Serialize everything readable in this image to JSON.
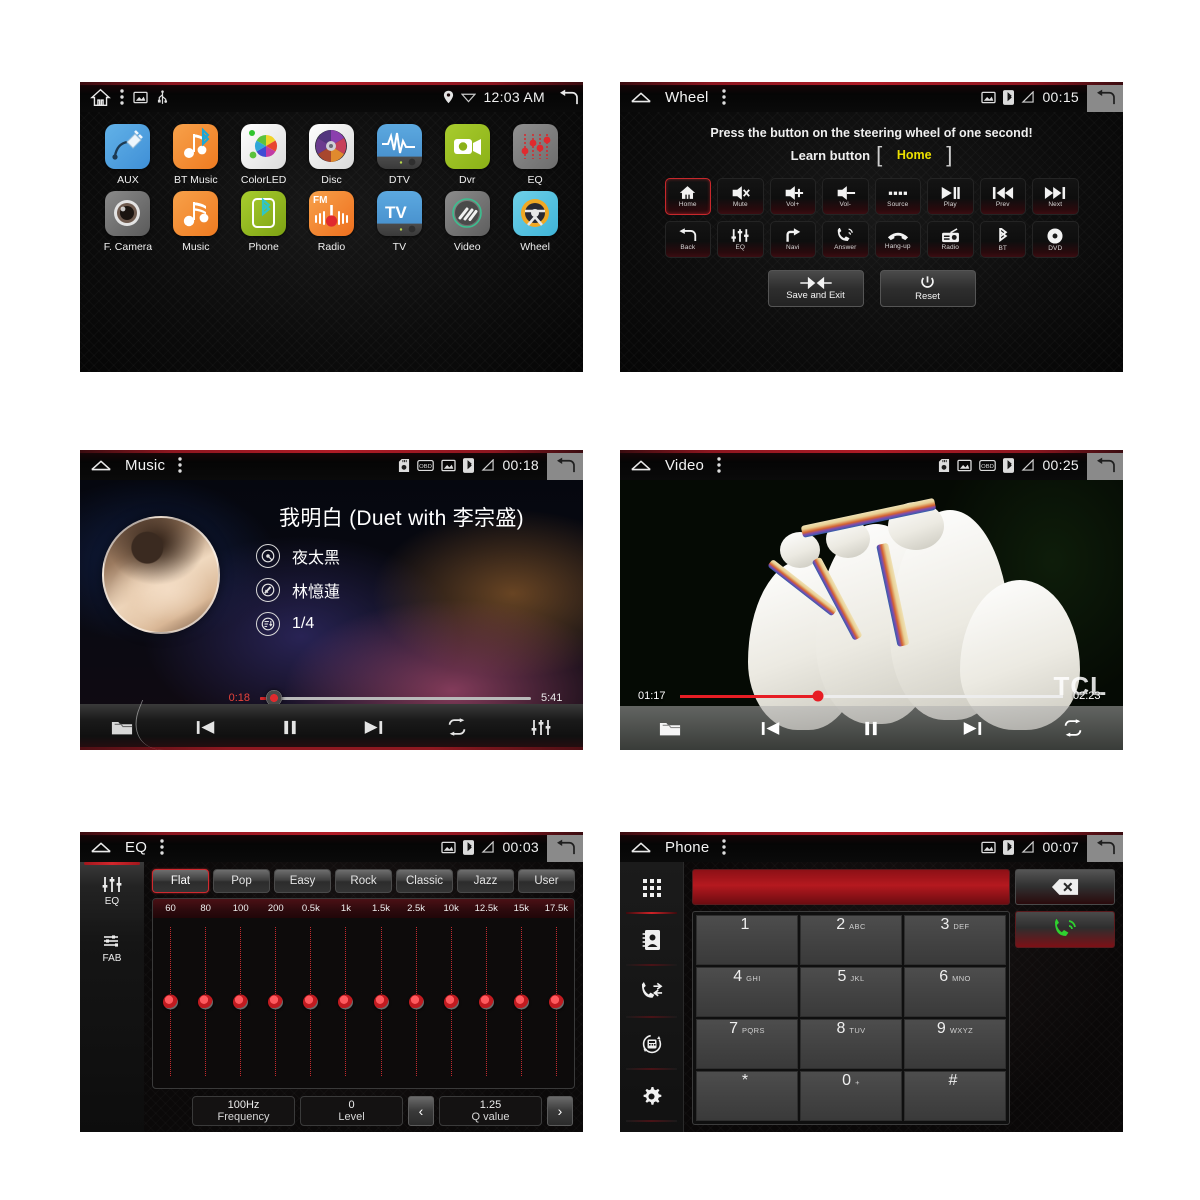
{
  "home": {
    "statusbar": {
      "icons": [
        "home-icon",
        "overflow-menu-icon",
        "gallery-icon",
        "usb-icon"
      ],
      "right_icons": [
        "location-pin-icon",
        "wifi-icon"
      ],
      "time": "12:03 AM",
      "back": "back-icon"
    },
    "apps": [
      {
        "label": "AUX",
        "icon": "aux-plug-icon"
      },
      {
        "label": "BT Music",
        "icon": "bt-music-icon"
      },
      {
        "label": "ColorLED",
        "icon": "color-wheel-icon"
      },
      {
        "label": "Disc",
        "icon": "disc-icon"
      },
      {
        "label": "DTV",
        "icon": "dtv-waveform-icon"
      },
      {
        "label": "Dvr",
        "icon": "dvr-camera-icon"
      },
      {
        "label": "EQ",
        "icon": "eq-sliders-icon"
      },
      {
        "label": "F. Camera",
        "icon": "front-camera-icon"
      },
      {
        "label": "Music",
        "icon": "music-note-icon"
      },
      {
        "label": "Phone",
        "icon": "phone-bluetooth-icon"
      },
      {
        "label": "Radio",
        "icon": "radio-fm-icon"
      },
      {
        "label": "TV",
        "icon": "tv-icon"
      },
      {
        "label": "Video",
        "icon": "video-icon"
      },
      {
        "label": "Wheel",
        "icon": "steering-wheel-icon"
      }
    ]
  },
  "wheel": {
    "statusbar": {
      "title": "Wheel",
      "time": "00:15"
    },
    "instruction": "Press the button on the steering wheel of one second!",
    "learn_label": "Learn button",
    "learn_value": "Home",
    "learn_value_color": "#ece000",
    "buttons": [
      {
        "label": "Home",
        "icon": "home-icon",
        "selected": true
      },
      {
        "label": "Mute",
        "icon": "volume-mute-icon",
        "selected": false
      },
      {
        "label": "Vol+",
        "icon": "volume-up-icon",
        "selected": false
      },
      {
        "label": "Vol-",
        "icon": "volume-down-icon",
        "selected": false
      },
      {
        "label": "Source",
        "icon": "source-dots-icon",
        "selected": false
      },
      {
        "label": "Play",
        "icon": "play-pause-icon",
        "selected": false
      },
      {
        "label": "Prev",
        "icon": "prev-track-icon",
        "selected": false
      },
      {
        "label": "Next",
        "icon": "next-track-icon",
        "selected": false
      },
      {
        "label": "Back",
        "icon": "back-arrow-icon",
        "selected": false
      },
      {
        "label": "EQ",
        "icon": "eq-sliders-icon",
        "selected": false
      },
      {
        "label": "Navi",
        "icon": "navi-turn-icon",
        "selected": false
      },
      {
        "label": "Answer",
        "icon": "call-answer-icon",
        "selected": false
      },
      {
        "label": "Hang-up",
        "icon": "call-hangup-icon",
        "selected": false
      },
      {
        "label": "Radio",
        "icon": "radio-icon",
        "selected": false
      },
      {
        "label": "BT",
        "icon": "bluetooth-icon",
        "selected": false
      },
      {
        "label": "DVD",
        "icon": "dvd-disc-icon",
        "selected": false
      }
    ],
    "actions": [
      {
        "label": "Save and Exit",
        "icon": "save-exit-arrows-icon"
      },
      {
        "label": "Reset",
        "icon": "reset-circle-icon"
      }
    ]
  },
  "music": {
    "statusbar": {
      "title": "Music",
      "time": "00:18",
      "icons": [
        "sd-card-icon",
        "obd-icon",
        "gallery-icon",
        "bluetooth-icon",
        "signal-icon"
      ]
    },
    "track_title": "我明白 (Duet with 李宗盛)",
    "album": "夜太黑",
    "artist": "林憶蓮",
    "index": "1/4",
    "current_time": "0:18",
    "total_time": "5:41",
    "progress_percent": 5,
    "controls": [
      "folder-icon",
      "prev-track-icon",
      "pause-icon",
      "next-track-icon",
      "repeat-icon",
      "eq-sliders-icon"
    ]
  },
  "video": {
    "statusbar": {
      "title": "Video",
      "time": "00:25",
      "icons": [
        "sd-card-icon",
        "gallery-icon",
        "obd-icon",
        "bluetooth-icon",
        "signal-icon"
      ]
    },
    "current_time": "01:17",
    "total_time": "02:23",
    "progress_percent": 36,
    "watermark": "TCL",
    "controls": [
      "folder-icon",
      "prev-track-icon",
      "pause-icon",
      "next-track-icon",
      "repeat-icon"
    ]
  },
  "eq": {
    "statusbar": {
      "title": "EQ",
      "time": "00:03"
    },
    "sidebar": [
      {
        "label": "EQ",
        "icon": "eq-sliders-icon",
        "active": true
      },
      {
        "label": "FAB",
        "icon": "fader-balance-icon",
        "active": false
      }
    ],
    "presets": [
      {
        "label": "Flat",
        "selected": true
      },
      {
        "label": "Pop",
        "selected": false
      },
      {
        "label": "Easy",
        "selected": false
      },
      {
        "label": "Rock",
        "selected": false
      },
      {
        "label": "Classic",
        "selected": false
      },
      {
        "label": "Jazz",
        "selected": false
      },
      {
        "label": "User",
        "selected": false
      }
    ],
    "bands": [
      "60",
      "80",
      "100",
      "200",
      "0.5k",
      "1k",
      "1.5k",
      "2.5k",
      "10k",
      "12.5k",
      "15k",
      "17.5k"
    ],
    "band_levels": [
      0,
      0,
      0,
      0,
      0,
      0,
      0,
      0,
      0,
      0,
      0,
      0
    ],
    "fields": [
      {
        "value": "100Hz",
        "key": "Frequency"
      },
      {
        "value": "0",
        "key": "Level"
      },
      {
        "value": "1.25",
        "key": "Q value"
      }
    ],
    "nav_prev": "‹",
    "nav_next": "›"
  },
  "phone": {
    "statusbar": {
      "title": "Phone",
      "time": "00:07"
    },
    "sidebar": [
      {
        "icon": "dialpad-icon",
        "active": true
      },
      {
        "icon": "contacts-icon",
        "active": false
      },
      {
        "icon": "call-log-icon",
        "active": false
      },
      {
        "icon": "sync-contacts-icon",
        "active": false
      },
      {
        "icon": "settings-gear-icon",
        "active": false
      }
    ],
    "number_value": "",
    "number_placeholder": "",
    "delete_icon": "backspace-icon",
    "call_icon": "call-green-icon",
    "keys": [
      {
        "n": "1",
        "s": ""
      },
      {
        "n": "2",
        "s": "ABC"
      },
      {
        "n": "3",
        "s": "DEF"
      },
      {
        "n": "4",
        "s": "GHI"
      },
      {
        "n": "5",
        "s": "JKL"
      },
      {
        "n": "6",
        "s": "MNO"
      },
      {
        "n": "7",
        "s": "PQRS"
      },
      {
        "n": "8",
        "s": "TUV"
      },
      {
        "n": "9",
        "s": "WXYZ"
      },
      {
        "n": "*",
        "s": ""
      },
      {
        "n": "0",
        "s": "+"
      },
      {
        "n": "#",
        "s": ""
      }
    ]
  }
}
